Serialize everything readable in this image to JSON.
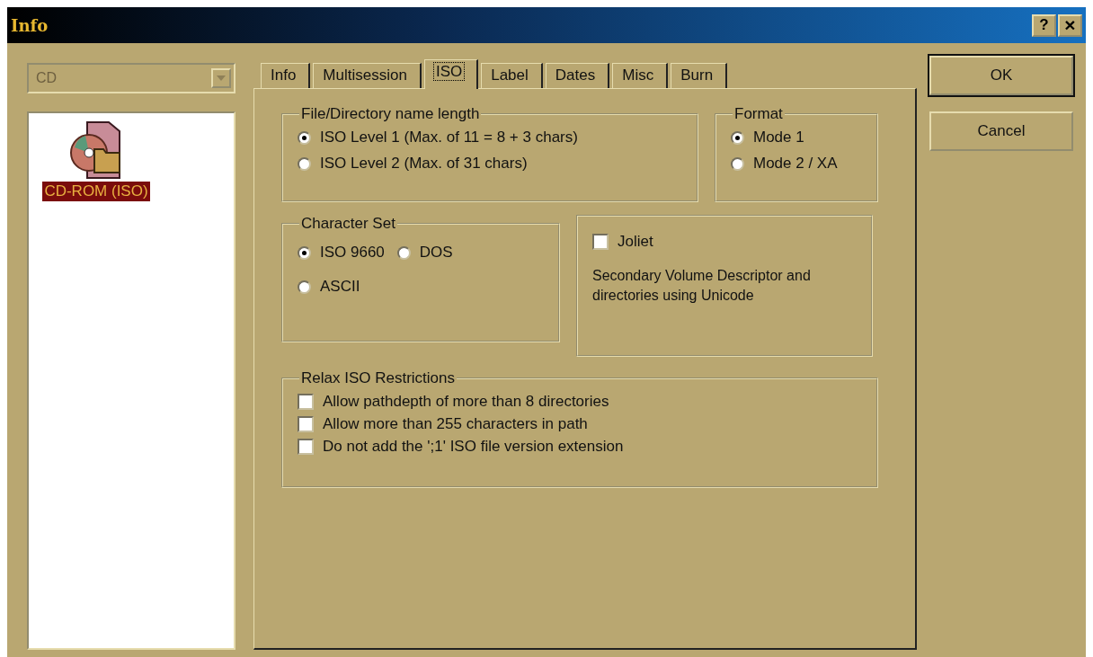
{
  "window": {
    "title": "Info",
    "controls": [
      {
        "kind": "help",
        "label": "?"
      },
      {
        "kind": "close",
        "label": "×"
      }
    ]
  },
  "drive_combo": {
    "value": "CD",
    "disabled": true
  },
  "list": {
    "items": [
      {
        "label": "CD-ROM (ISO)",
        "selected": true
      }
    ]
  },
  "tabs": [
    {
      "label": "Info",
      "selected": false
    },
    {
      "label": "Multisession",
      "selected": false
    },
    {
      "label": "ISO",
      "selected": true
    },
    {
      "label": "Label",
      "selected": false
    },
    {
      "label": "Dates",
      "selected": false
    },
    {
      "label": "Misc",
      "selected": false
    },
    {
      "label": "Burn",
      "selected": false
    }
  ],
  "name_length": {
    "title": "File/Directory name length",
    "options": [
      {
        "label": "ISO Level 1 (Max. of 11 = 8 + 3 chars)",
        "selected": true
      },
      {
        "label": "ISO Level 2 (Max. of 31 chars)",
        "selected": false
      }
    ]
  },
  "format": {
    "title": "Format",
    "options": [
      {
        "label": "Mode 1",
        "selected": true
      },
      {
        "label": "Mode 2 / XA",
        "selected": false
      }
    ]
  },
  "character_set": {
    "title": "Character Set",
    "options": [
      {
        "label": "ISO 9660",
        "selected": true
      },
      {
        "label": "DOS",
        "selected": false
      },
      {
        "label": "ASCII",
        "selected": false
      }
    ]
  },
  "joliet": {
    "label": "Joliet",
    "checked": false,
    "description": "Secondary Volume Descriptor and directories using Unicode"
  },
  "relax": {
    "title": "Relax ISO Restrictions",
    "options": [
      {
        "label": "Allow pathdepth of more than 8 directories",
        "checked": false
      },
      {
        "label": "Allow more than 255 characters in path",
        "checked": false
      },
      {
        "label": "Do not add the ';1' ISO file version extension",
        "checked": false
      }
    ]
  },
  "buttons": [
    {
      "label": "OK",
      "default": true
    },
    {
      "label": "Cancel",
      "default": false
    }
  ]
}
